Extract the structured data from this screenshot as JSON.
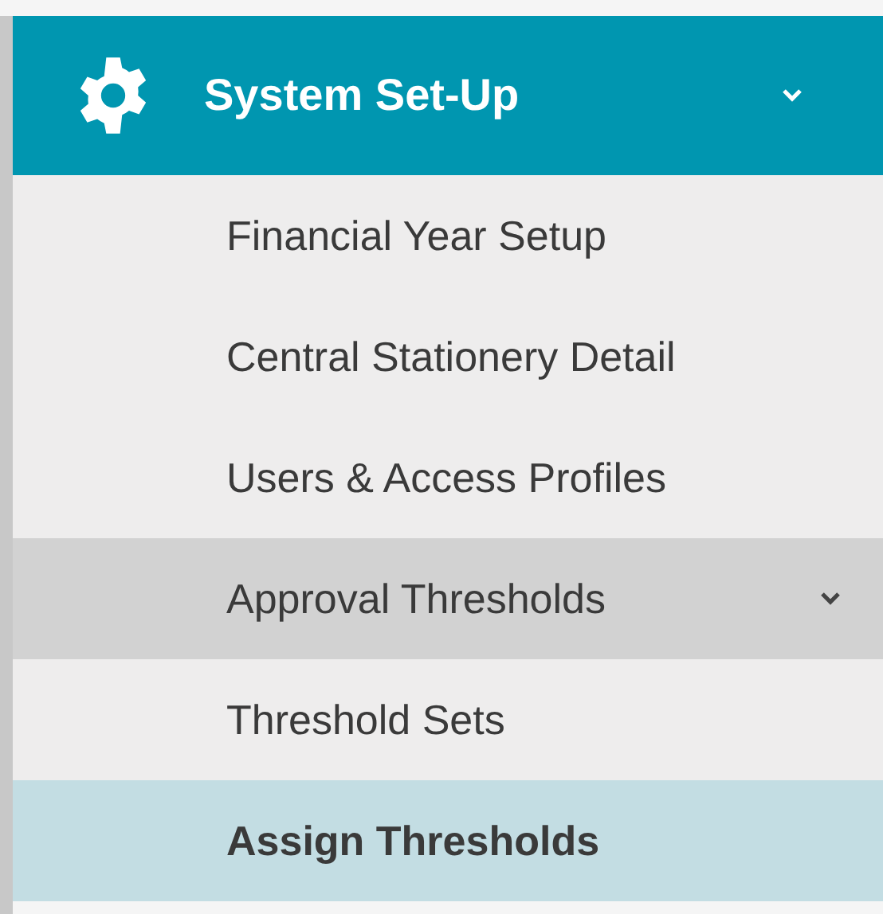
{
  "menu": {
    "title": "System Set-Up",
    "expanded": true,
    "items": [
      {
        "label": "Financial Year Setup",
        "selected": false
      },
      {
        "label": "Central Stationery Detail",
        "selected": false
      },
      {
        "label": "Users & Access Profiles",
        "selected": false
      },
      {
        "label": "Approval Thresholds",
        "selected": false,
        "expanded": true,
        "children": [
          {
            "label": "Threshold Sets",
            "selected": false
          },
          {
            "label": "Assign Thresholds",
            "selected": true
          }
        ]
      }
    ]
  }
}
